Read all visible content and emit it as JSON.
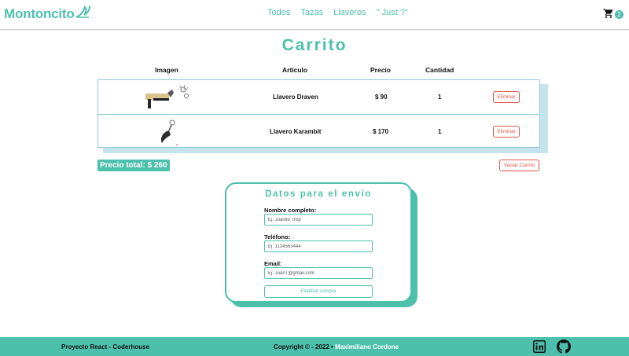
{
  "navbar": {
    "brand": "Montoncito",
    "links": [
      "Todos",
      "Tazas",
      "Llaveros",
      "\" Just ?\""
    ],
    "cart_count": "2"
  },
  "page_title": "Carrito",
  "table": {
    "headers": [
      "Imagen",
      "Artículo",
      "Precio",
      "Cantidad"
    ],
    "rows": [
      {
        "name": "Llavero Draven",
        "price": "$ 90",
        "qty": "1",
        "remove_label": "Eliminar"
      },
      {
        "name": "Llavero Karambit",
        "price": "$ 170",
        "qty": "1",
        "remove_label": "Eliminar"
      }
    ]
  },
  "total_label": "Precio total: $ 260",
  "clear_cart_label": "Vaciar Carrito",
  "form": {
    "title": "Datos para el envío",
    "fields": [
      {
        "label": "Nombre completo:",
        "placeholder": "Ej: Juanito Trop"
      },
      {
        "label": "Teléfono:",
        "placeholder": "Ej: 1134563444"
      },
      {
        "label": "Email:",
        "placeholder": "Ej: JuanT@gmail.com"
      }
    ],
    "submit_label": "Finalizar compra"
  },
  "footer": {
    "left": "Proyecto React - Coderhouse",
    "center_prefix": "Copyright © - 2022 •",
    "author": "Maximiliano Cordone"
  },
  "colors": {
    "accent": "#4dc0ac",
    "danger": "#e1574a",
    "table_border": "#8ec8dc"
  },
  "icons": {
    "brand": "wave-icon",
    "cart": "cart-icon",
    "linkedin": "linkedin-icon",
    "github": "github-icon"
  }
}
